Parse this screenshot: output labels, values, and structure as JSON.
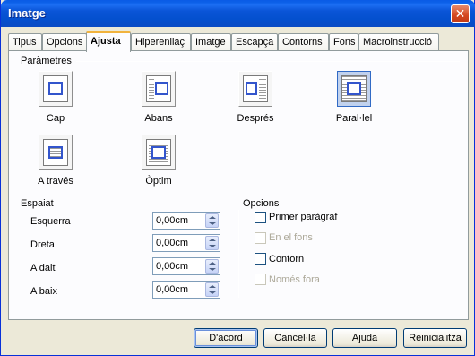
{
  "window": {
    "title": "Imatge"
  },
  "tabs": [
    {
      "label": "Tipus"
    },
    {
      "label": "Opcions"
    },
    {
      "label": "Ajusta"
    },
    {
      "label": "Hiperenllaç"
    },
    {
      "label": "Imatge"
    },
    {
      "label": "Escapça"
    },
    {
      "label": "Contorns"
    },
    {
      "label": "Fons"
    },
    {
      "label": "Macroinstrucció"
    }
  ],
  "parametres": {
    "title": "Paràmetres",
    "options": [
      {
        "label": "Cap"
      },
      {
        "label": "Abans"
      },
      {
        "label": "Després"
      },
      {
        "label": "Paral·lel"
      },
      {
        "label": "A través"
      },
      {
        "label": "Òptim"
      }
    ],
    "selected": "Paral·lel"
  },
  "espaiat": {
    "title": "Espaiat",
    "rows": [
      {
        "label": "Esquerra",
        "value": "0,00cm"
      },
      {
        "label": "Dreta",
        "value": "0,00cm"
      },
      {
        "label": "A dalt",
        "value": "0,00cm"
      },
      {
        "label": "A baix",
        "value": "0,00cm"
      }
    ]
  },
  "opcions": {
    "title": "Opcions",
    "items": [
      {
        "label": "Primer paràgraf",
        "enabled": true,
        "checked": false
      },
      {
        "label": "En el fons",
        "enabled": false,
        "checked": false
      },
      {
        "label": "Contorn",
        "enabled": true,
        "checked": false
      },
      {
        "label": "Només fora",
        "enabled": false,
        "checked": false
      }
    ]
  },
  "buttons": {
    "ok": "D'acord",
    "cancel": "Cancel·la",
    "help": "Ajuda",
    "reset": "Reinicialitza"
  }
}
